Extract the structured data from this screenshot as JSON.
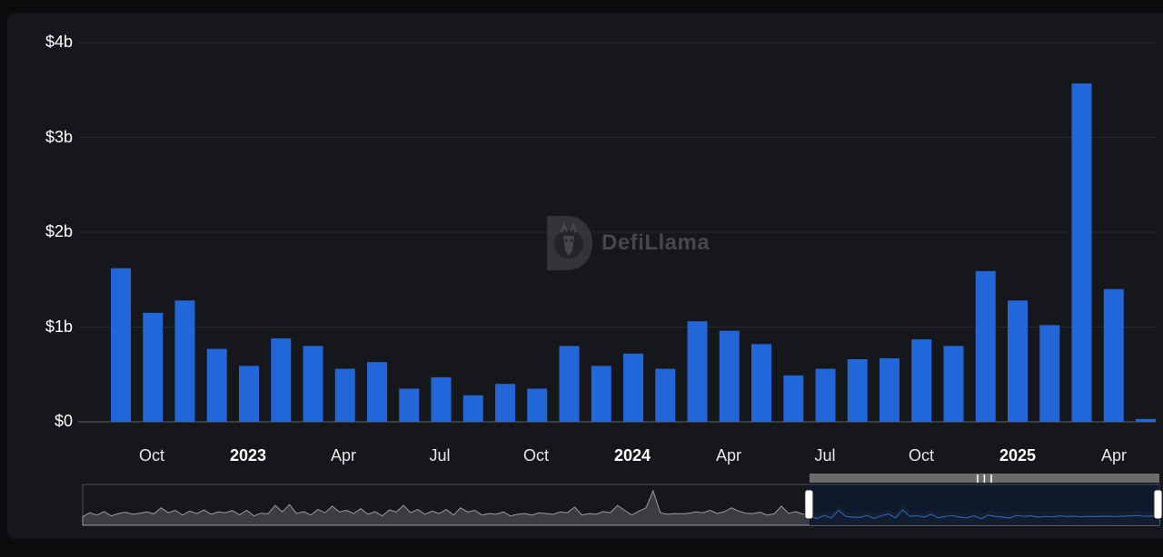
{
  "watermark": {
    "text": "DefiLlama"
  },
  "colors": {
    "bar": "#2167d9",
    "grid": "#26282c",
    "axis": "#5f6167",
    "background": "#16171a",
    "brush": "#6b6b6b"
  },
  "chart_data": {
    "type": "bar",
    "yticks": [
      "$0",
      "$1b",
      "$2b",
      "$3b",
      "$4b"
    ],
    "ylim": [
      0,
      4
    ],
    "y_unit": "billion USD",
    "xticks": [
      {
        "label": "Oct",
        "bold": false
      },
      {
        "label": "2023",
        "bold": true
      },
      {
        "label": "Apr",
        "bold": false
      },
      {
        "label": "Jul",
        "bold": false
      },
      {
        "label": "Oct",
        "bold": false
      },
      {
        "label": "2024",
        "bold": true
      },
      {
        "label": "Apr",
        "bold": false
      },
      {
        "label": "Jul",
        "bold": false
      },
      {
        "label": "Oct",
        "bold": false
      },
      {
        "label": "2025",
        "bold": true
      },
      {
        "label": "Apr",
        "bold": false
      }
    ],
    "categories": [
      "2022-09",
      "2022-10",
      "2022-11",
      "2022-12",
      "2023-01",
      "2023-02",
      "2023-03",
      "2023-04",
      "2023-05",
      "2023-06",
      "2023-07",
      "2023-08",
      "2023-09",
      "2023-10",
      "2023-11",
      "2023-12",
      "2024-01",
      "2024-02",
      "2024-03",
      "2024-04",
      "2024-05",
      "2024-06",
      "2024-07",
      "2024-08",
      "2024-09",
      "2024-10",
      "2024-11",
      "2024-12",
      "2025-01",
      "2025-02",
      "2025-03",
      "2025-04",
      "2025-05"
    ],
    "values": [
      1.62,
      1.15,
      1.28,
      0.77,
      0.59,
      0.88,
      0.8,
      0.56,
      0.63,
      0.35,
      0.47,
      0.28,
      0.4,
      0.35,
      0.8,
      0.59,
      0.72,
      0.56,
      1.06,
      0.96,
      0.82,
      0.49,
      0.56,
      0.66,
      0.67,
      0.87,
      0.8,
      1.59,
      1.28,
      1.02,
      3.57,
      1.4,
      0.03
    ],
    "grid": true,
    "legend": "none",
    "brush": {
      "overview_values": [
        0.3,
        0.55,
        0.4,
        0.62,
        0.35,
        0.5,
        0.58,
        0.45,
        0.52,
        0.6,
        0.48,
        0.85,
        0.55,
        0.7,
        0.4,
        0.65,
        0.5,
        0.72,
        0.45,
        0.6,
        0.55,
        0.68,
        0.42,
        0.7,
        0.35,
        0.52,
        0.48,
        1.0,
        0.6,
        1.05,
        0.5,
        0.62,
        0.4,
        0.75,
        0.55,
        0.95,
        0.6,
        0.7,
        0.5,
        0.8,
        0.45,
        0.62,
        0.35,
        0.72,
        0.6,
        1.0,
        0.55,
        0.75,
        0.45,
        0.65,
        0.5,
        0.75,
        0.4,
        0.85,
        0.6,
        0.7,
        0.4,
        0.5,
        0.45,
        0.6,
        0.35,
        0.45,
        0.5,
        0.4,
        0.55,
        0.5,
        0.45,
        0.6,
        0.55,
        0.9,
        0.4,
        0.5,
        0.45,
        0.62,
        0.55,
        1.0,
        0.7,
        0.4,
        0.65,
        0.85,
        1.9,
        0.55,
        0.45,
        0.5,
        0.48,
        0.52,
        0.6,
        0.55,
        0.7,
        0.5,
        0.62,
        0.85,
        0.65,
        0.52,
        0.5,
        0.58,
        0.4,
        0.48,
        0.95,
        0.5,
        0.62,
        0.45,
        0.55,
        0.42,
        0.6,
        0.45,
        0.92,
        0.55,
        0.5,
        0.48,
        0.6,
        0.42,
        0.58,
        0.7,
        0.45,
        0.95,
        0.55,
        0.6,
        0.5,
        0.68,
        0.45,
        0.55,
        0.6,
        0.5,
        0.45,
        0.58,
        0.4,
        0.62,
        0.55,
        0.5,
        0.45,
        0.6,
        0.55,
        0.58,
        0.5,
        0.55,
        0.52,
        0.58,
        0.54,
        0.56,
        0.52,
        0.55,
        0.53,
        0.56,
        0.55,
        0.54,
        0.56,
        0.58,
        0.6,
        0.55,
        0.57,
        0.54
      ],
      "selection_start": 0.675,
      "selection_end": 1.0
    }
  }
}
